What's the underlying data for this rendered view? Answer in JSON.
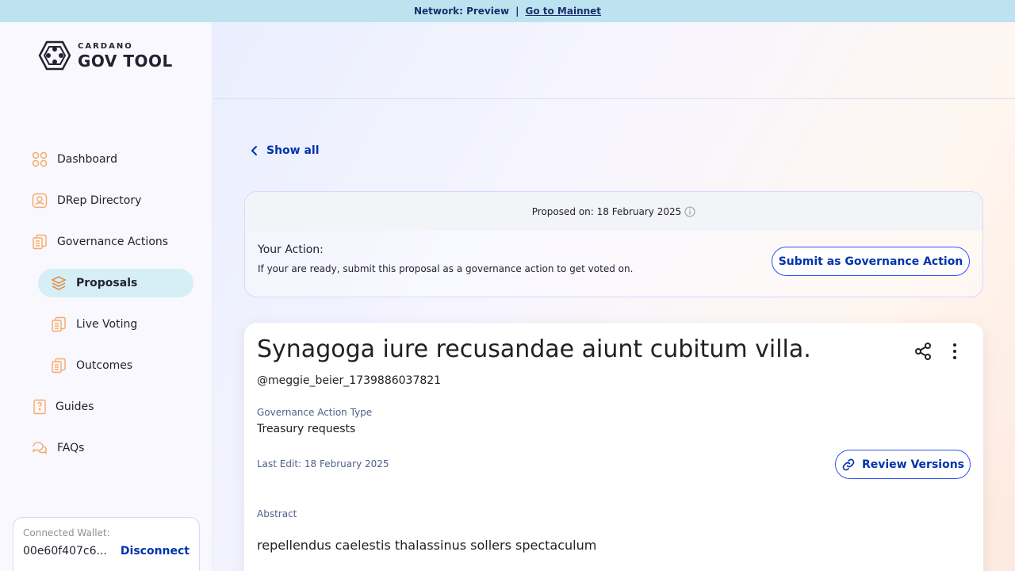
{
  "banner": {
    "text": "Network: Preview",
    "separator": "|",
    "link": "Go to Mainnet"
  },
  "logo": {
    "small": "CARDANO",
    "big": "GOV TOOL"
  },
  "sidebar": {
    "items": [
      {
        "label": "Dashboard",
        "icon": "dashboard-icon"
      },
      {
        "label": "DRep Directory",
        "icon": "drep-directory-icon"
      },
      {
        "label": "Governance Actions",
        "icon": "governance-actions-icon"
      },
      {
        "label": "Proposals",
        "icon": "proposals-icon",
        "active": true
      },
      {
        "label": "Live Voting",
        "icon": "live-voting-icon"
      },
      {
        "label": "Outcomes",
        "icon": "outcomes-icon"
      },
      {
        "label": "Guides",
        "icon": "guides-icon"
      },
      {
        "label": "FAQs",
        "icon": "faqs-icon"
      }
    ]
  },
  "wallet": {
    "label": "Connected Wallet:",
    "address": "00e60f407c6...",
    "disconnect": "Disconnect"
  },
  "back": {
    "label": "Show all"
  },
  "action_card": {
    "proposed_on": "Proposed on: 18 February 2025",
    "title": "Your Action:",
    "description": "If your are ready, submit this proposal as a governance action to get voted on.",
    "submit_label": "Submit as Governance Action"
  },
  "proposal": {
    "title": "Synagoga iure recusandae aiunt cubitum villa.",
    "author": "@meggie_beier_1739886037821",
    "type_label": "Governance Action Type",
    "type_value": "Treasury requests",
    "last_edit": "Last Edit: 18 February 2025",
    "review_label": "Review Versions",
    "abstract_label": "Abstract",
    "abstract": "repellendus caelestis thalassinus sollers spectaculum"
  },
  "colors": {
    "accent": "#0033ad",
    "active_nav": "#d6eef6",
    "banner": "#bde3f0",
    "icon_orange": "#f6a96a"
  }
}
